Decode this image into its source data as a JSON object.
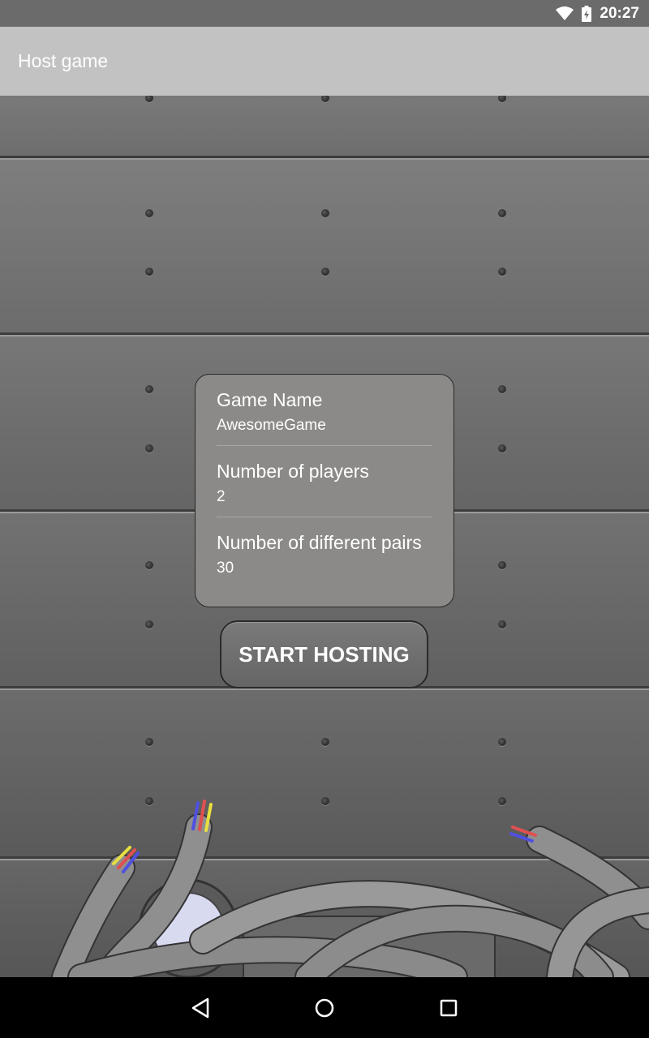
{
  "status_bar": {
    "time": "20:27",
    "icons": [
      "wifi-icon",
      "battery-charging-icon"
    ]
  },
  "app_bar": {
    "title": "Host game",
    "color": "#c2c2c3"
  },
  "settings": {
    "items": [
      {
        "title": "Game Name",
        "value": "AwesomeGame"
      },
      {
        "title": "Number of players",
        "value": "2"
      },
      {
        "title": "Number of different pairs",
        "value": "30"
      }
    ]
  },
  "start_button": {
    "label": "START HOSTING"
  },
  "nav_bar": {
    "icons": [
      "back-icon",
      "home-icon",
      "recents-icon"
    ]
  },
  "colors": {
    "background_metal": "#6a6a6a",
    "card": "#8b8a88",
    "text": "#ffffff",
    "nav": "#000000"
  }
}
